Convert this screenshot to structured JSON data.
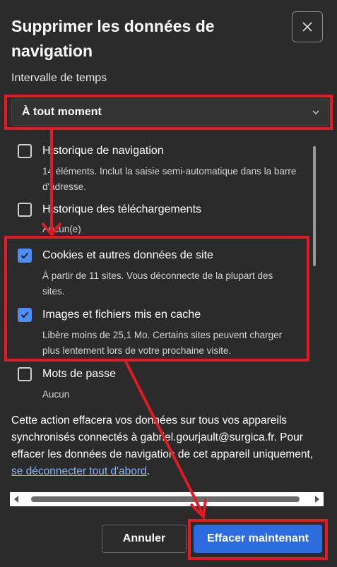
{
  "dialog": {
    "title": "Supprimer les données de navigation",
    "time_range_label": "Intervalle de temps",
    "time_range_value": "À tout moment"
  },
  "items": [
    {
      "title": "Historique de navigation",
      "desc": "14 éléments. Inclut la saisie semi-automatique dans la barre d'adresse.",
      "checked": false
    },
    {
      "title": "Historique des téléchargements",
      "desc": "Aucun(e)",
      "checked": false
    },
    {
      "title": "Cookies et autres données de site",
      "desc": "À partir de 11 sites. Vous déconnecte de la plupart des sites.",
      "checked": true
    },
    {
      "title": "Images et fichiers mis en cache",
      "desc": "Libère moins de 25,1 Mo. Certains sites peuvent charger plus lentement lors de votre prochaine visite.",
      "checked": true
    },
    {
      "title": "Mots de passe",
      "desc": "Aucun",
      "checked": false
    }
  ],
  "note": {
    "text": "Cette action effacera vos données sur tous vos appareils synchronisés connectés à gabriel.gourjault@surgica.fr. Pour effacer les données de navigation de cet appareil uniquement, ",
    "link": "se déconnecter tout d'abord",
    "end": "."
  },
  "buttons": {
    "cancel": "Annuler",
    "clear": "Effacer maintenant"
  },
  "colors": {
    "background": "#2b2b2b",
    "accent": "#2d6be0",
    "checkbox": "#4c8df6",
    "link": "#8ab4f8",
    "annotation": "#e01b24"
  },
  "icons": {
    "close": "close-icon",
    "dropdown": "chevron-down-icon",
    "check": "check-icon"
  }
}
